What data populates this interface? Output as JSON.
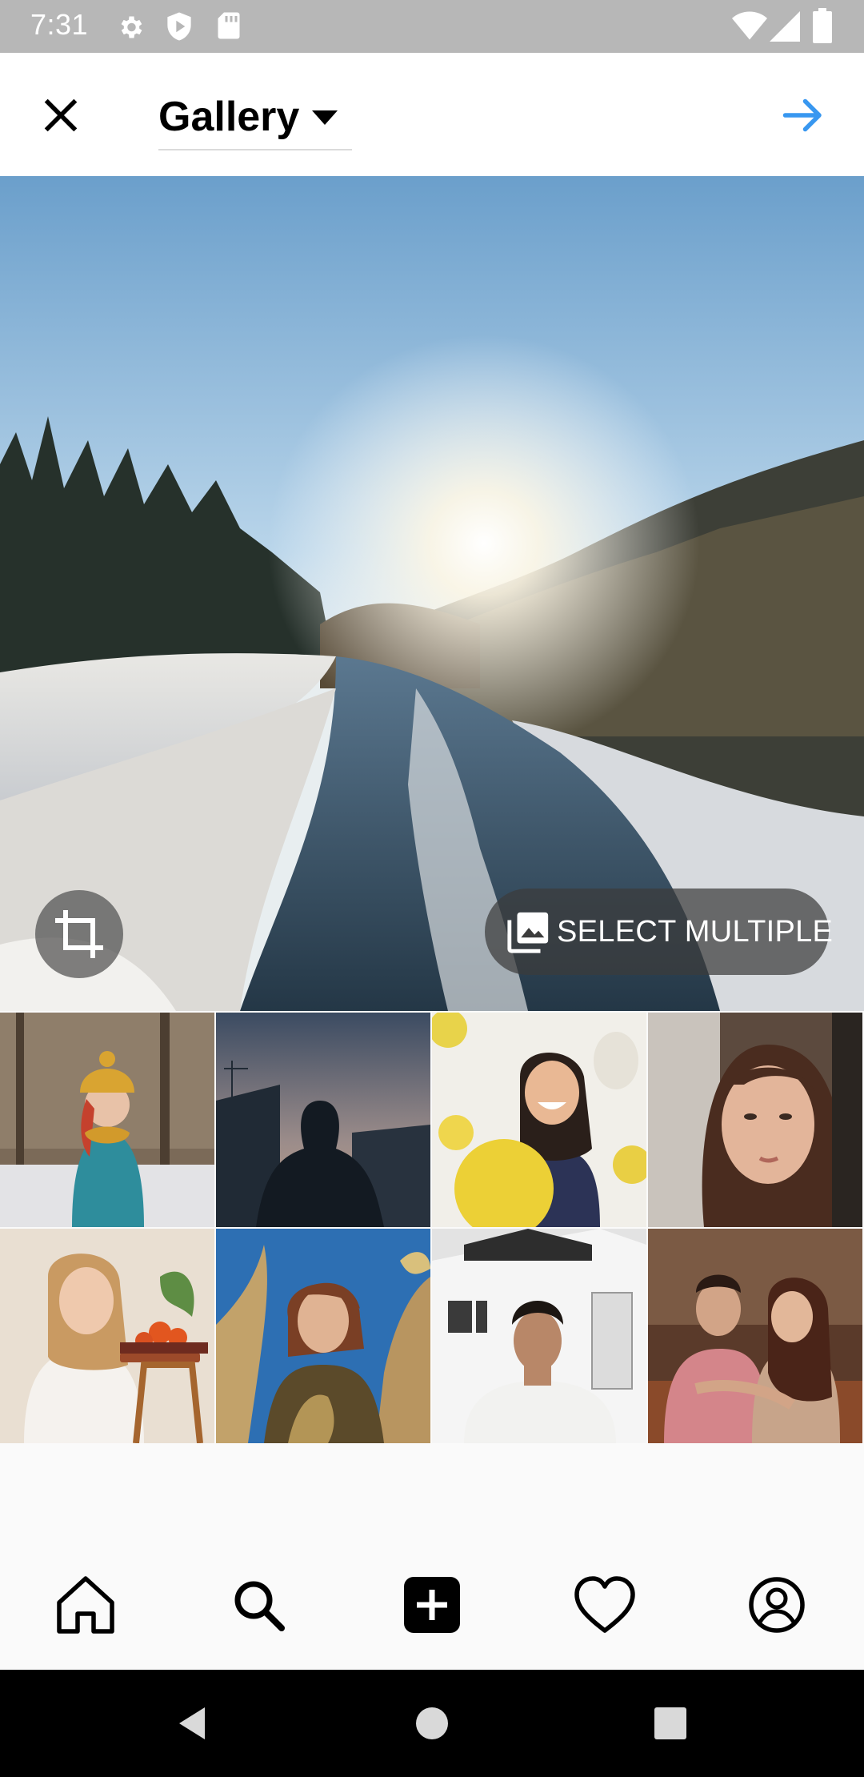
{
  "status_bar": {
    "time": "7:31",
    "icons": [
      "settings-icon",
      "play-protect-icon",
      "sd-card-icon",
      "wifi-icon",
      "signal-icon",
      "battery-icon"
    ]
  },
  "header": {
    "close_icon": "close-icon",
    "title": "Gallery",
    "dropdown_icon": "caret-down-icon",
    "next_icon": "arrow-right-icon",
    "accent_color": "#3897f0"
  },
  "preview": {
    "crop_icon": "crop-icon",
    "select_multiple_label": "SELECT MULTIPLE",
    "select_multiple_icon": "gallery-stack-icon"
  },
  "grid": {
    "items": [
      {
        "name": "thumb-woman-yellow-beanie"
      },
      {
        "name": "thumb-silhouette-dusk"
      },
      {
        "name": "thumb-woman-yellow-balloons"
      },
      {
        "name": "thumb-woman-closeup"
      },
      {
        "name": "thumb-woman-blonde-oranges"
      },
      {
        "name": "thumb-woman-pampas-grass"
      },
      {
        "name": "thumb-man-white-shirt"
      },
      {
        "name": "thumb-couple-autumn"
      }
    ]
  },
  "bottom_nav": {
    "items": [
      "home-icon",
      "search-icon",
      "add-post-icon",
      "heart-icon",
      "profile-icon"
    ]
  },
  "android_nav": {
    "items": [
      "back-icon",
      "home-circle-icon",
      "recents-icon"
    ]
  }
}
